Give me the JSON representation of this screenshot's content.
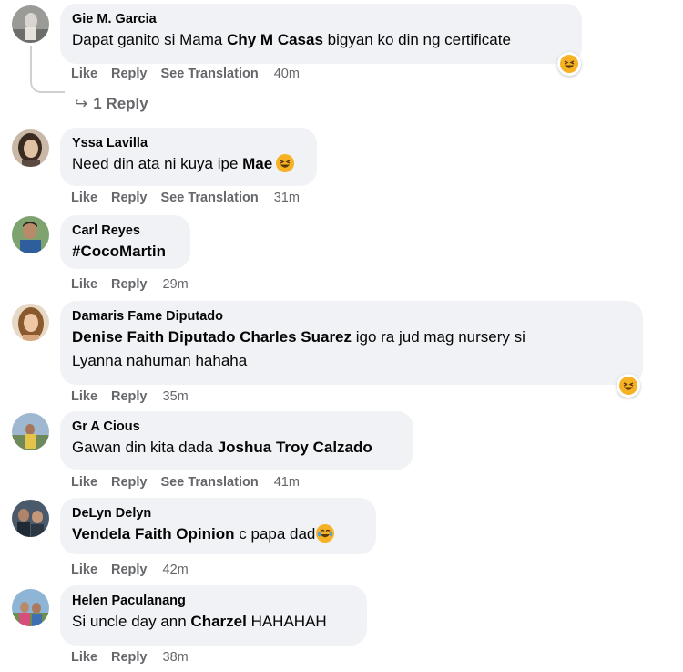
{
  "comments": [
    {
      "author": "Gie M. Garcia",
      "text_before": "Dapat ganito si Mama ",
      "mention": "Chy M Casas",
      "text_after": " bigyan ko din ng certificate",
      "actions": {
        "like": "Like",
        "reply": "Reply",
        "translate": "See Translation",
        "time": "40m"
      },
      "reaction": "haha"
    },
    {
      "author": "Yssa Lavilla",
      "text_before": "Need din ata ni kuya ipe ",
      "mention": "Mae",
      "text_after": "",
      "actions": {
        "like": "Like",
        "reply": "Reply",
        "translate": "See Translation",
        "time": "31m"
      }
    },
    {
      "author": "Carl Reyes",
      "text_before": "",
      "mention": "#CocoMartin",
      "text_after": "",
      "actions": {
        "like": "Like",
        "reply": "Reply",
        "time": "29m"
      }
    },
    {
      "author": "Damaris Fame Diputado",
      "text_before": "",
      "mention": "Denise Faith Diputado Charles Suarez",
      "text_after": " igo ra jud mag nursery si",
      "text_line2": "Lyanna nahuman hahaha",
      "actions": {
        "like": "Like",
        "reply": "Reply",
        "time": "35m"
      },
      "reaction": "haha"
    },
    {
      "author": "Gr A Cious",
      "text_before": "Gawan din kita dada ",
      "mention": "Joshua Troy Calzado",
      "text_after": "",
      "actions": {
        "like": "Like",
        "reply": "Reply",
        "translate": "See Translation",
        "time": "41m"
      }
    },
    {
      "author": "DeLyn Delyn",
      "text_before": "",
      "mention": "Vendela Faith Opinion",
      "text_after": " c papa dad",
      "actions": {
        "like": "Like",
        "reply": "Reply",
        "time": "42m"
      }
    },
    {
      "author": "Helen Paculanang",
      "text_before": "Si uncle day ann ",
      "mention": "Charzel",
      "text_after": " HAHAHAH",
      "actions": {
        "like": "Like",
        "reply": "Reply",
        "time": "38m"
      }
    }
  ],
  "replies_link": {
    "arrow": "↪",
    "label": "1 Reply"
  },
  "colors": {
    "bubble": "#f0f2f5",
    "secondary_text": "#65676b",
    "emoji_face": "#f7b125"
  }
}
